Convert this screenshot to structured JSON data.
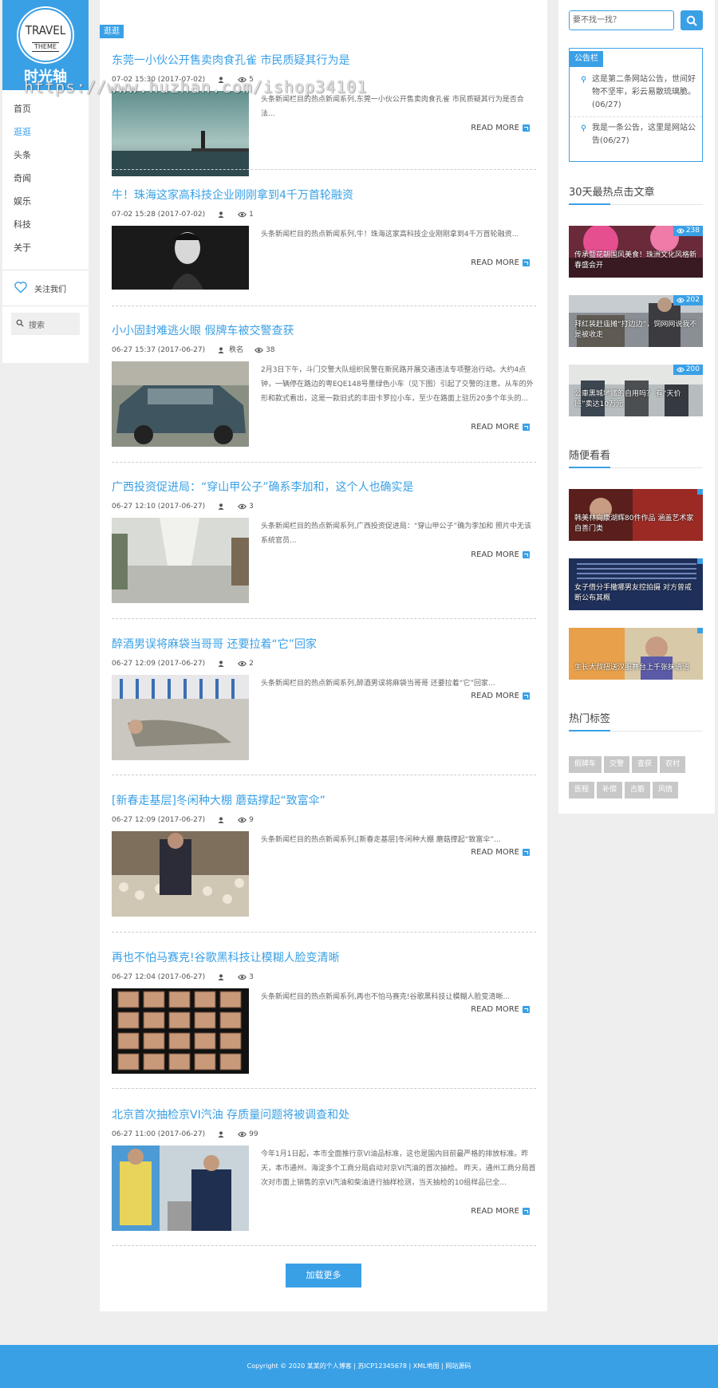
{
  "logo": {
    "line1": "TRAVEL",
    "line2": "THEME",
    "title": "时光轴"
  },
  "nav": {
    "items": [
      {
        "label": "首页",
        "active": false
      },
      {
        "label": "逛逛",
        "active": true
      },
      {
        "label": "头条",
        "active": false
      },
      {
        "label": "奇闻",
        "active": false
      },
      {
        "label": "娱乐",
        "active": false
      },
      {
        "label": "科技",
        "active": false
      },
      {
        "label": "关于",
        "active": false
      }
    ],
    "follow_label": "关注我们",
    "search_placeholder": "搜索"
  },
  "breadcrumb": "逛逛",
  "read_more_label": "READ MORE",
  "articles": [
    {
      "title": "东莞一小伙公开售卖肉食孔雀 市民质疑其行为是",
      "date": "07-02 15:30 (2017-07-02)",
      "views": "5",
      "excerpt": "头条新闻栏目的热点新闻系列,东莞一小伙公开售卖肉食孔雀 市民质疑其行为是否合法..."
    },
    {
      "title": "牛！珠海这家高科技企业刚刚拿到4千万首轮融资",
      "date": "07-02 15:28 (2017-07-02)",
      "views": "1",
      "excerpt": "头条新闻栏目的热点新闻系列,牛！珠海这家高科技企业刚刚拿到4千万首轮融资..."
    },
    {
      "title": "小小固封难逃火眼 假牌车被交警查获",
      "date": "06-27 15:37 (2017-06-27)",
      "author": "秩名",
      "views": "38",
      "excerpt": "2月3日下午，斗门交警大队组织民警在新民路开展交通违法专项整治行动。大约4点钟，一辆停在路边的粤EQE148号墨绿色小车（见下图）引起了交警的注意。从车的外形和款式看出，这是一款旧式的丰田卡罗拉小车，至少在路面上驻历20多个年头的..."
    },
    {
      "title": "广西投资促进局：“穿山甲公子”确系李加和，这个人也确实是",
      "date": "06-27 12:10 (2017-06-27)",
      "views": "3",
      "excerpt": "头条新闻栏目的热点新闻系列,广西投资促进局：“穿山甲公子”确为李加和 照片中无该系统官员..."
    },
    {
      "title": "醉酒男误将麻袋当哥哥 还要拉着“它”回家",
      "date": "06-27 12:09 (2017-06-27)",
      "views": "2",
      "excerpt": "头条新闻栏目的热点新闻系列,醉酒男误将麻袋当哥哥 还要拉着“它”回家..."
    },
    {
      "title": "[新春走基层]冬闲种大棚 蘑菇撑起“致富伞”",
      "date": "06-27 12:09 (2017-06-27)",
      "views": "9",
      "excerpt": "头条新闻栏目的热点新闻系列,[新春走基层]冬闲种大棚 蘑菇撑起“致富伞”..."
    },
    {
      "title": "再也不怕马赛克!谷歌黑科技让模糊人脸变清晰",
      "date": "06-27 12:04 (2017-06-27)",
      "views": "3",
      "excerpt": "头条新闻栏目的热点新闻系列,再也不怕马赛克!谷歌黑科技让模糊人脸变清晰..."
    },
    {
      "title": "北京首次抽检京VI汽油 存质量问题将被调查和处",
      "date": "06-27 11:00 (2017-06-27)",
      "views": "99",
      "excerpt": "今年1月1日起，本市全面推行京VI油品标准，这也是国内目前最严格的排放标准。昨天，本市通州、海淀多个工商分局启动对京VI汽油的首次抽检。 昨天，通州工商分局首次对市面上销售的京VI汽油和柴油进行抽样检测，当天抽检的10组样品已全..."
    }
  ],
  "load_more_label": "加载更多",
  "sidebar": {
    "search_placeholder": "要不找一找？",
    "notice": {
      "title": "公告栏",
      "items": [
        "这是第二条网站公告，世间好物不坚牢，彩云易散琉璃脆。(06/27)",
        "我是一条公告，这里是网站公告(06/27)"
      ]
    },
    "hot_title": "30天最热点击文章",
    "hot": [
      {
        "caption": "传承暨花朝国风美食！珠洲文化风格新春盛会开",
        "views": "238"
      },
      {
        "caption": "拜红装赶庙摊“打边边”，饲网网说我不是被收走",
        "views": "202"
      },
      {
        "caption": "公車黑城地鐵的自用吗？ 有“天价班”卖达10万元",
        "views": "200"
      }
    ],
    "random_title": "随便看看",
    "random": [
      {
        "caption": "韩美林向康湖辉80件作品 涵盖艺术家自善门类"
      },
      {
        "caption": "女子借分手撒哪男友控拍摄 对方曾戒断公布其概"
      },
      {
        "caption": "生长大叔扭送汉服舞台上千张抹语语"
      }
    ],
    "tags_title": "热门标签",
    "tags": [
      "假牌车",
      "交警",
      "查获",
      "农村",
      "医程",
      "补偿",
      "古筋",
      "风情"
    ]
  },
  "footer": "Copyright © 2020 某某的个人博客 | 苏ICP12345678 | XML地图 | 网站源码",
  "watermark": "https://www.huzhan.com/ishop34101"
}
